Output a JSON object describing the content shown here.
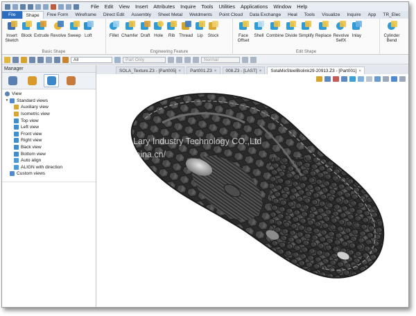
{
  "menubar": {
    "items": [
      "File",
      "Edit",
      "View",
      "Insert",
      "Attributes",
      "Inquire",
      "Tools",
      "Utilities",
      "Applications",
      "Window",
      "Help"
    ]
  },
  "ribbon_tabs": [
    "File",
    "Shape",
    "Free Form",
    "Wireframe",
    "Direct Edit",
    "Assembly",
    "Sheet Metal",
    "Weldments",
    "Point Cloud",
    "Data Exchange",
    "Heal",
    "Tools",
    "Visualize",
    "Inquire",
    "App",
    "TR_Elec"
  ],
  "ribbon": {
    "groups": [
      {
        "title": "Basic Shape",
        "buttons": [
          "Insert Sketch",
          "Block",
          "Extrude",
          "Revolve",
          "Sweep",
          "Loft"
        ]
      },
      {
        "title": "Engineering Feature",
        "buttons": [
          "Fillet",
          "Chamfer",
          "Draft",
          "Hole",
          "Rib",
          "Thread",
          "Lip",
          "Stock"
        ]
      },
      {
        "title": "Edit Shape",
        "buttons": [
          "Face Offset",
          "Shell",
          "Combine",
          "Divide",
          "Simplify",
          "Replace",
          "Revolve SelfX",
          "Inlay"
        ]
      },
      {
        "title": "",
        "buttons": [
          "Cylinder Bend"
        ]
      }
    ]
  },
  "toolbar": {
    "filter_value": "All",
    "part_value": "Part Only",
    "render_value": "Normal"
  },
  "manager": {
    "title": "Manager",
    "tree": {
      "root": "View",
      "standard": "Standard views",
      "children": [
        "Auxiliary view",
        "Isometric view",
        "Top view",
        "Left view",
        "Front view",
        "Right view",
        "Back view",
        "Bottom view",
        "Auto align",
        "ALIGN with direction"
      ],
      "custom": "Custom views"
    }
  },
  "doc_tabs": [
    "SOLA_Texture.Z3 - [Part005]",
    "Part001.Z3",
    "008.Z3 - [LAST]",
    "SolaMixSteelBiolink29-20913.Z3 - [Part001]"
  ],
  "watermark": [
    "Ningbo Lary Industry Technology CO.,Ltd",
    "lary.en.china.cn/"
  ],
  "colors": {
    "file_tab": "#2c6cc0",
    "model_dark": "#3a3a3a",
    "model_light": "#bdbdbd"
  }
}
